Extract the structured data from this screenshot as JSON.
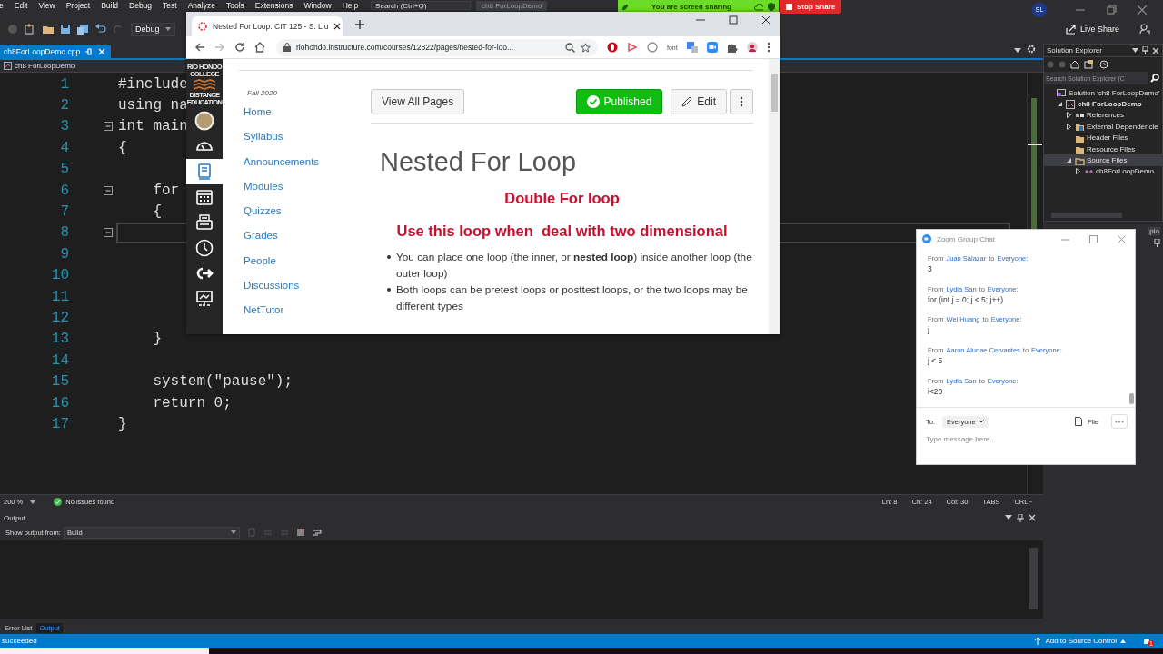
{
  "ide": {
    "menu": [
      "e",
      "Edit",
      "View",
      "Project",
      "Build",
      "Debug",
      "Test",
      "Analyze",
      "Tools",
      "Extensions",
      "Window",
      "Help"
    ],
    "search": {
      "placeholder": "Search (Ctrl+Q)"
    },
    "solution_title": "ch8 ForLoopDemo",
    "account_initials": "SL",
    "configuration": "Debug",
    "live_share": "Live Share",
    "doc_tab": {
      "label": "ch8ForLoopDemo.cpp",
      "selected": true
    },
    "nav_project": "ch8 ForLoopDemo",
    "code_lines": [
      {
        "number": "1",
        "text": "#include",
        "fold": false,
        "current": false
      },
      {
        "number": "2",
        "text": "using na",
        "fold": false,
        "current": false
      },
      {
        "number": "3",
        "text": "int main",
        "fold": true,
        "current": false
      },
      {
        "number": "4",
        "text": "{",
        "fold": false,
        "current": false
      },
      {
        "number": "5",
        "fold": false,
        "current": false
      },
      {
        "number": "6",
        "text": "    for",
        "fold": true,
        "current": false
      },
      {
        "number": "7",
        "text": "    {",
        "fold": false,
        "current": false
      },
      {
        "number": "8",
        "fold": true,
        "current": true
      },
      {
        "number": "9",
        "fold": false,
        "current": false
      },
      {
        "number": "10",
        "fold": false,
        "current": false
      },
      {
        "number": "11",
        "fold": false,
        "current": false
      },
      {
        "number": "12",
        "fold": false,
        "current": false
      },
      {
        "number": "13",
        "text": "    }",
        "fold": false,
        "current": false
      },
      {
        "number": "14",
        "fold": false,
        "current": false
      },
      {
        "number": "15",
        "text": "    system(\"pause\");",
        "fold": false,
        "current": false
      },
      {
        "number": "16",
        "text": "    return 0;",
        "fold": false,
        "current": false
      },
      {
        "number": "17",
        "text": "}",
        "fold": false,
        "current": false
      }
    ],
    "editor_status": {
      "zoom": "200 %",
      "issues": "No issues found",
      "line": "Ln: 8",
      "char": "Ch: 24",
      "col": "Col: 30",
      "indent": "TABS",
      "eol": "CRLF"
    },
    "solution_explorer": {
      "title": "Solution Explorer",
      "search": {
        "placeholder": "Search Solution Explorer (C"
      },
      "tree": [
        {
          "label": "Solution 'ch8 ForLoopDemo'",
          "kind": "solution",
          "selected": false,
          "children": [
            {
              "label": "ch8 ForLoopDemo",
              "kind": "project",
              "expanded": true,
              "selected": false,
              "children": [
                {
                  "label": "References",
                  "kind": "references",
                  "expanded": false,
                  "selected": false
                },
                {
                  "label": "External Dependencie",
                  "kind": "external",
                  "expanded": false,
                  "selected": false
                },
                {
                  "label": "Header Files",
                  "kind": "folder",
                  "selected": false
                },
                {
                  "label": "Resource Files",
                  "kind": "folder",
                  "selected": false
                },
                {
                  "label": "Source Files",
                  "kind": "filter",
                  "expanded": true,
                  "selected": true,
                  "children": [
                    {
                      "label": "ch8ForLoopDemo",
                      "kind": "cpp",
                      "expanded": false,
                      "selected": false
                    }
                  ]
                }
              ]
            }
          ]
        }
      ]
    },
    "side_fragment": "plo",
    "output": {
      "title": "Output",
      "show_from_label": "Show output from:",
      "source": "Build"
    },
    "bottom_tabs": [
      {
        "label": "Error List",
        "selected": false
      },
      {
        "label": "Output",
        "selected": true
      }
    ],
    "status_bar": {
      "message": "succeeded",
      "source_control": "Add to Source Control",
      "notifications": "1"
    }
  },
  "zoom_share": {
    "banner": "You are screen sharing",
    "stop": "Stop Share"
  },
  "browser": {
    "tab": {
      "title": "Nested For Loop: CIT 125 - S. Liu",
      "selected": true
    },
    "url": "riohondo.instructure.com/courses/12822/pages/nested-for-loo...",
    "extension_label": "font",
    "logo": {
      "top": "RIO HONDO COLLEGE",
      "bottom": "DISTANCE EDUCATION"
    },
    "global_nav": [
      {
        "kind": "avatar",
        "selected": false
      },
      {
        "kind": "dashboard",
        "selected": false
      },
      {
        "kind": "courses",
        "selected": true
      },
      {
        "kind": "calendar",
        "selected": false
      },
      {
        "kind": "inbox",
        "selected": false
      },
      {
        "kind": "history",
        "selected": false
      },
      {
        "kind": "commons",
        "selected": false
      },
      {
        "kind": "studio",
        "selected": false
      }
    ],
    "term": "Fall 2020",
    "course_nav": [
      "Home",
      "Syllabus",
      "Announcements",
      "Modules",
      "Quizzes",
      "Grades",
      "People",
      "Discussions",
      "NetTutor"
    ],
    "view_all": "View All Pages",
    "publish": {
      "label": "Published",
      "published": true
    },
    "edit": "Edit",
    "page": {
      "title": "Nested For Loop",
      "headings": [
        "Double For loop",
        "Use this loop when  deal with two dimensional"
      ],
      "bullets": [
        "You can place one loop (the inner, or **nested loop**) inside another loop (the outer loop)",
        "Both loops can be pretest loops or posttest loops, or the two loops may be different types"
      ]
    }
  },
  "chat": {
    "title": "Zoom Group Chat",
    "messages": [
      {
        "prefix": "From",
        "sender": "Juan Salazar",
        "joiner": "to",
        "recipient": "Everyone:",
        "text": "3"
      },
      {
        "prefix": "From",
        "sender": "Lydia San",
        "joiner": "to",
        "recipient": "Everyone:",
        "text": "for (int j = 0; j < 5; j++)"
      },
      {
        "prefix": "From",
        "sender": "Wei Huang",
        "joiner": "to",
        "recipient": "Everyone:",
        "text": "j"
      },
      {
        "prefix": "From",
        "sender": "Aaron Alunae Cervantes",
        "joiner": "to",
        "recipient": "Everyone:",
        "text": "j < 5"
      },
      {
        "prefix": "From",
        "sender": "Lydia San",
        "joiner": "to",
        "recipient": "Everyone:",
        "text": "i<20"
      }
    ],
    "to_label": "To:",
    "recipient": "Everyone",
    "file": "File",
    "placeholder": "Type message here..."
  }
}
